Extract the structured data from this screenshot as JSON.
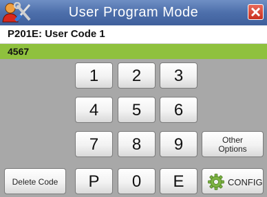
{
  "titlebar": {
    "title": "User Program Mode",
    "user_icon": "user-tools-icon",
    "close_icon": "close-icon"
  },
  "program": {
    "label": "P201E: User Code 1"
  },
  "code": {
    "value": "4567"
  },
  "keypad": {
    "row1": [
      "1",
      "2",
      "3"
    ],
    "row2": [
      "4",
      "5",
      "6"
    ],
    "row3": [
      "7",
      "8",
      "9"
    ],
    "row4": [
      "P",
      "0",
      "E"
    ]
  },
  "buttons": {
    "other_line1": "Other",
    "other_line2": "Options",
    "delete": "Delete Code",
    "config": "CONFIG",
    "config_icon": "gear-icon"
  },
  "colors": {
    "title_bar": "#4d6fab",
    "code_bar": "#8fc13e",
    "background": "#a8a8a8",
    "close": "#c9301f",
    "gear": "#7cb342"
  }
}
